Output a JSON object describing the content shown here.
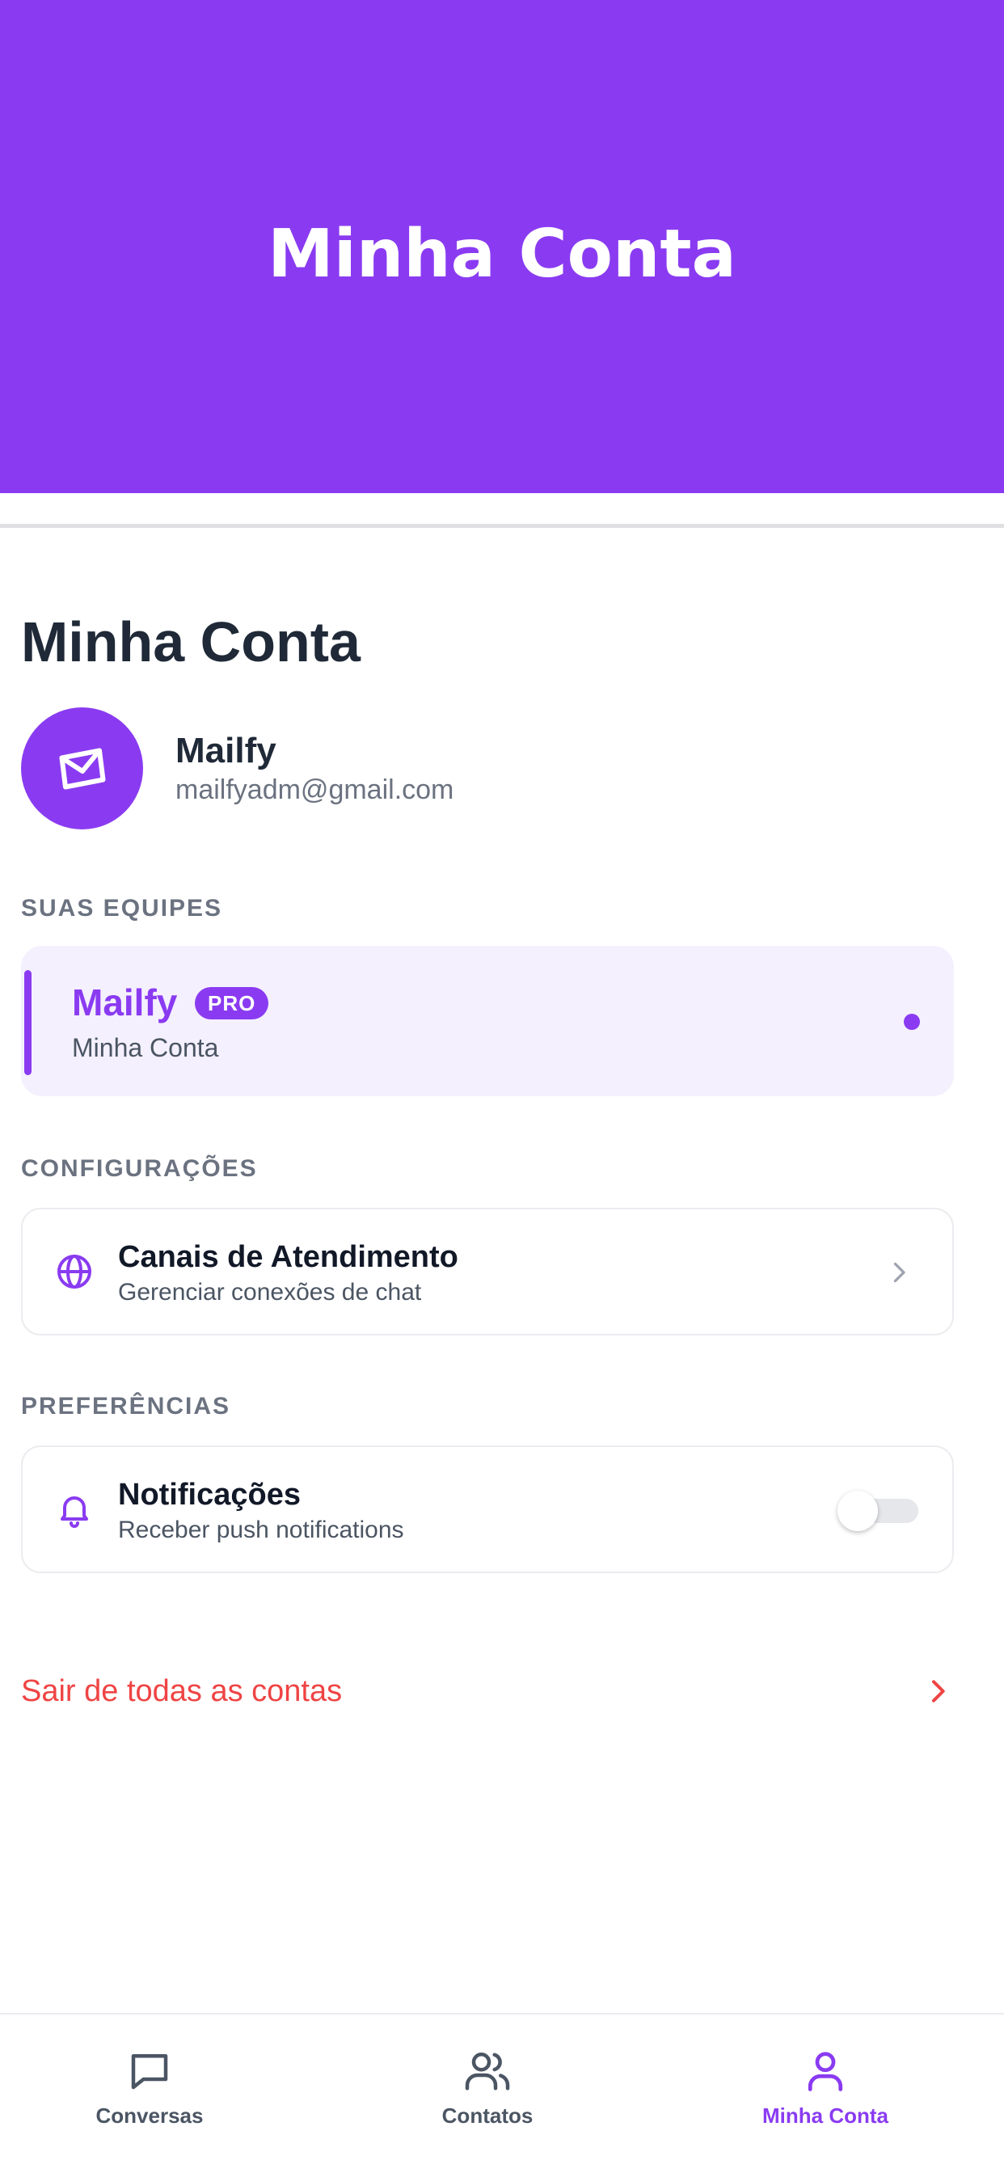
{
  "header": {
    "title": "Minha Conta"
  },
  "page": {
    "title": "Minha Conta"
  },
  "profile": {
    "name": "Mailfy",
    "email": "mailfyadm@gmail.com",
    "avatar_icon": "mail-open-icon"
  },
  "teams": {
    "section_label": "SUAS EQUIPES",
    "items": [
      {
        "name": "Mailfy",
        "badge": "PRO",
        "subtitle": "Minha Conta",
        "selected": true
      }
    ]
  },
  "settings": {
    "section_label": "CONFIGURAÇÕES",
    "items": [
      {
        "icon": "globe-icon",
        "title": "Canais de Atendimento",
        "subtitle": "Gerenciar conexões de chat"
      }
    ]
  },
  "preferences": {
    "section_label": "PREFERÊNCIAS",
    "items": [
      {
        "icon": "bell-icon",
        "title": "Notificações",
        "subtitle": "Receber push notifications",
        "enabled": false
      }
    ]
  },
  "logout": {
    "label": "Sair de todas as contas"
  },
  "tabbar": {
    "tabs": [
      {
        "label": "Conversas",
        "icon": "chat-bubble-icon",
        "active": false
      },
      {
        "label": "Contatos",
        "icon": "users-icon",
        "active": false
      },
      {
        "label": "Minha Conta",
        "icon": "user-icon",
        "active": true
      }
    ]
  },
  "colors": {
    "brand": "#8a3bf1",
    "danger": "#ef4444",
    "card_highlight": "#f4f0fe"
  }
}
